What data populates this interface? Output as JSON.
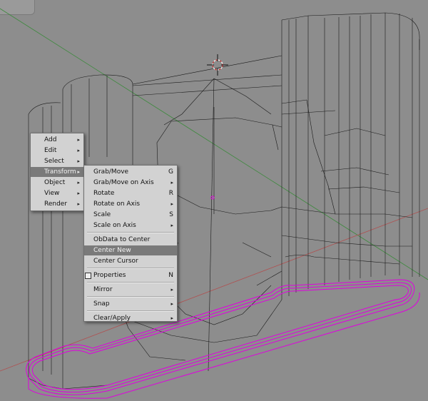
{
  "main_menu": {
    "items": [
      {
        "label": "Add",
        "submenu": true
      },
      {
        "label": "Edit",
        "submenu": true
      },
      {
        "label": "Select",
        "submenu": true
      },
      {
        "label": "Transform",
        "submenu": true,
        "highlighted": true
      },
      {
        "label": "Object",
        "submenu": true
      },
      {
        "label": "View",
        "submenu": true
      },
      {
        "label": "Render",
        "submenu": true
      }
    ],
    "arrow_glyph": "▸"
  },
  "transform_menu": {
    "items": [
      {
        "label": "Grab/Move",
        "shortcut": "G"
      },
      {
        "label": "Grab/Move on Axis",
        "submenu": true
      },
      {
        "label": "Rotate",
        "shortcut": "R"
      },
      {
        "label": "Rotate on Axis",
        "submenu": true
      },
      {
        "label": "Scale",
        "shortcut": "S"
      },
      {
        "label": "Scale on Axis",
        "submenu": true
      },
      {
        "label": "ObData to Center"
      },
      {
        "label": "Center New",
        "highlighted": true
      },
      {
        "label": "Center Cursor"
      },
      {
        "label": "Properties",
        "shortcut": "N",
        "checkbox": true
      },
      {
        "label": "Mirror",
        "submenu": true
      },
      {
        "label": "Snap",
        "submenu": true
      },
      {
        "label": "Clear/Apply",
        "submenu": true
      }
    ]
  },
  "colors": {
    "viewport_bg": "#8d8d8d",
    "wire": "#1a1a1a",
    "selected_edges": "#e000e0",
    "axis_green": "#3c8a3c",
    "axis_red": "#b05050",
    "menu_bg": "#d2d2d2",
    "menu_highlight": "#7a7a7a"
  },
  "icons": {
    "cursor": "3d-cursor-icon",
    "object_center": "object-center-icon"
  }
}
